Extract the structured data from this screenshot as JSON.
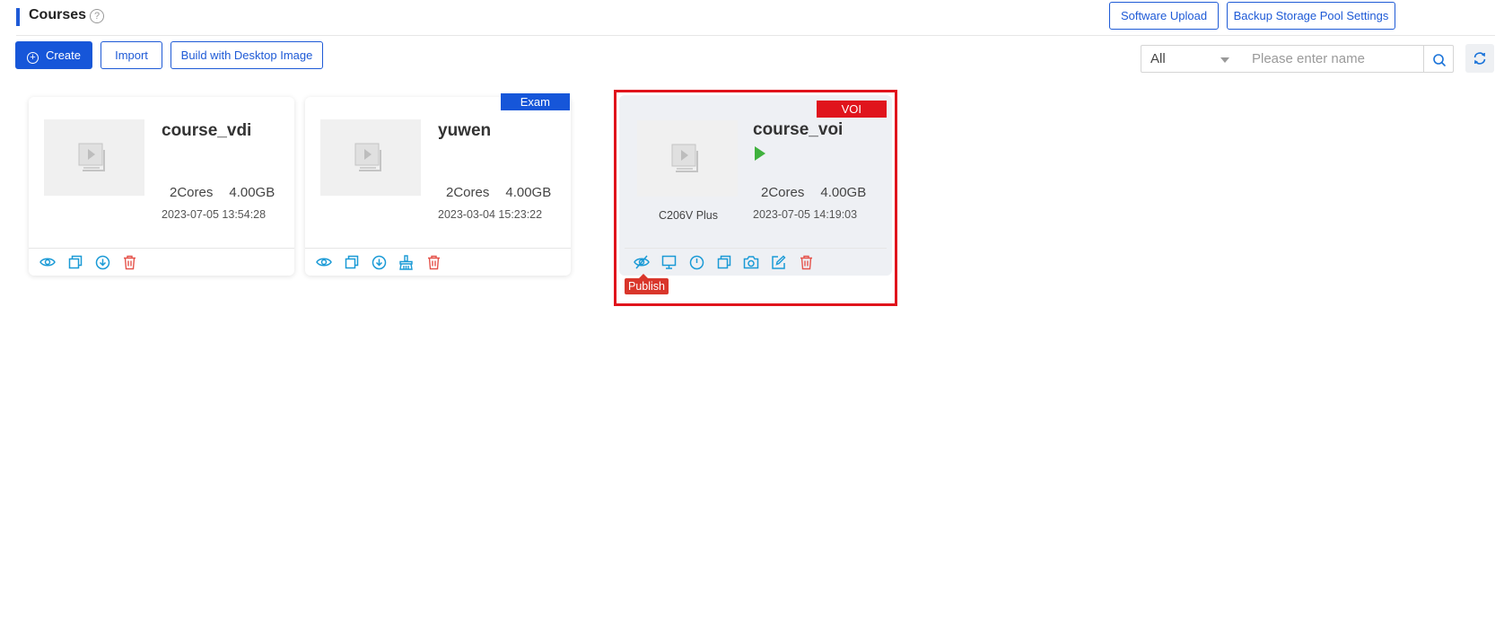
{
  "header": {
    "title": "Courses",
    "help": "?",
    "software_upload": "Software Upload",
    "backup_settings": "Backup Storage Pool Settings"
  },
  "toolbar": {
    "create_label": "Create",
    "create_icon": "plus-circle-icon",
    "import_label": "Import",
    "build_label": "Build with Desktop Image",
    "filter_value": "All",
    "search_placeholder": "Please enter name"
  },
  "colors": {
    "primary": "#1656d9",
    "exam_tag": "#1656d9",
    "voi_tag": "#e0141c",
    "icon_blue": "#1a9ad6",
    "icon_red": "#e5534b",
    "play_green": "#3fb13d",
    "highlight": "#e0141c"
  },
  "cards": [
    {
      "name": "course_vdi",
      "cores": "2Cores",
      "memory": "4.00GB",
      "time": "2023-07-05 13:54:28",
      "actions": [
        "eye-icon",
        "copy-icon",
        "download-icon",
        "delete-icon"
      ]
    },
    {
      "name": "yuwen",
      "tag": "Exam",
      "cores": "2Cores",
      "memory": "4.00GB",
      "time": "2023-03-04 15:23:22",
      "actions": [
        "eye-icon",
        "copy-icon",
        "download-icon",
        "clean-icon",
        "delete-icon"
      ]
    },
    {
      "name": "course_voi",
      "tag": "VOI",
      "status": "running",
      "terminal": "C206V Plus",
      "cores": "2Cores",
      "memory": "4.00GB",
      "time": "2023-07-05 14:19:03",
      "actions": [
        "publish-icon",
        "desktop-icon",
        "power-icon",
        "copy-icon",
        "camera-icon",
        "edit-icon",
        "delete-icon"
      ],
      "tooltip": "Publish"
    }
  ]
}
